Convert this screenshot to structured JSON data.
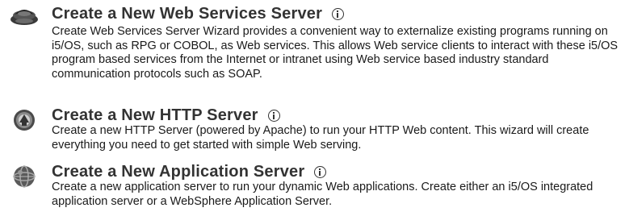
{
  "items": [
    {
      "title": "Create a New Web Services Server",
      "description": "Create Web Services Server Wizard provides a convenient way to externalize existing programs running on i5/OS, such as RPG or COBOL, as Web services. This allows Web service clients to interact with these i5/OS program based services from the Internet or intranet using Web service based industry standard communication protocols such as SOAP.",
      "icon": "web-services-server-icon"
    },
    {
      "title": "Create a New HTTP Server",
      "description": "Create a new HTTP Server (powered by Apache) to run your HTTP Web content. This wizard will create everything you need to get started with simple Web serving.",
      "icon": "http-server-icon"
    },
    {
      "title": "Create a New Application Server",
      "description": "Create a new application server to run your dynamic Web applications. Create either an i5/OS integrated application server or a WebSphere Application Server.",
      "icon": "application-server-icon"
    }
  ],
  "info_icon": "info-icon"
}
